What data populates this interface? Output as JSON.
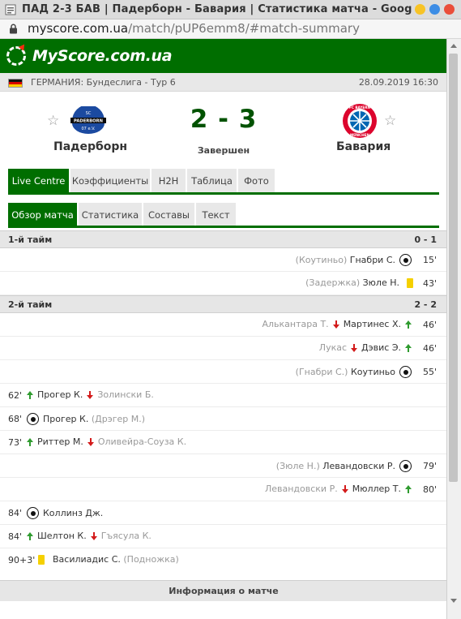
{
  "browser": {
    "title": "ПАД 2-3 БАВ | Падерборн - Бавария | Статистика матча - Goog",
    "url_host": "myscore.com.ua",
    "url_path": "/match/pUP6emm8/#match-summary"
  },
  "site": {
    "logo_text": "MyScore.com.ua"
  },
  "league": {
    "name": "ГЕРМАНИЯ: Бундеслига - Тур 6",
    "datetime": "28.09.2019 16:30"
  },
  "match": {
    "home_team": "Падерборн",
    "away_team": "Бавария",
    "score": "2 - 3",
    "status": "Завершен",
    "home_crest_text": "SC PADERBORN 07 e.V.",
    "away_crest_text": "FC BAYERN MÜNCHEN"
  },
  "tabs": [
    "Live Centre",
    "Коэффициенты",
    "H2H",
    "Таблица",
    "Фото"
  ],
  "subtabs": [
    "Обзор матча",
    "Статистика",
    "Составы",
    "Текст"
  ],
  "halves": [
    {
      "title": "1-й тайм",
      "score": "0 - 1",
      "incidents": [
        {
          "side": "away",
          "minute": "15'",
          "type": "goal",
          "player": "Гнабри С.",
          "note": "(Коутиньо)"
        },
        {
          "side": "away",
          "minute": "43'",
          "type": "yellow-card",
          "player": "Зюле Н.",
          "note": "(Задержка)"
        }
      ]
    },
    {
      "title": "2-й тайм",
      "score": "2 - 2",
      "incidents": [
        {
          "side": "away",
          "minute": "46'",
          "type": "substitution",
          "player_in": "Мартинес Х.",
          "player_out": "Алькантара Т."
        },
        {
          "side": "away",
          "minute": "46'",
          "type": "substitution",
          "player_in": "Дэвис Э.",
          "player_out": "Лукас"
        },
        {
          "side": "away",
          "minute": "55'",
          "type": "goal",
          "player": "Коутиньо",
          "note": "(Гнабри С.)"
        },
        {
          "side": "home",
          "minute": "62'",
          "type": "substitution",
          "player_in": "Прогер К.",
          "player_out": "Золински Б."
        },
        {
          "side": "home",
          "minute": "68'",
          "type": "goal",
          "player": "Прогер К.",
          "note": "(Дрэгер М.)"
        },
        {
          "side": "home",
          "minute": "73'",
          "type": "substitution",
          "player_in": "Риттер М.",
          "player_out": "Оливейра-Соуза К."
        },
        {
          "side": "away",
          "minute": "79'",
          "type": "goal",
          "player": "Левандовски Р.",
          "note": "(Зюле Н.)"
        },
        {
          "side": "away",
          "minute": "80'",
          "type": "substitution",
          "player_in": "Мюллер Т.",
          "player_out": "Левандовски Р."
        },
        {
          "side": "home",
          "minute": "84'",
          "type": "goal",
          "player": "Коллинз Дж.",
          "note": ""
        },
        {
          "side": "home",
          "minute": "84'",
          "type": "substitution",
          "player_in": "Шелтон К.",
          "player_out": "Гъясула К."
        },
        {
          "side": "home",
          "minute": "90+3'",
          "type": "yellow-card",
          "player": "Василиадис С.",
          "note": "(Подножка)"
        }
      ]
    }
  ],
  "footer": {
    "info_label": "Информация о матче"
  },
  "colors": {
    "brand_green": "#006e00",
    "score_green": "#005200",
    "sub_in": "#2f9b2f",
    "sub_out": "#d31b1b",
    "yellow_card": "#f5d000"
  }
}
